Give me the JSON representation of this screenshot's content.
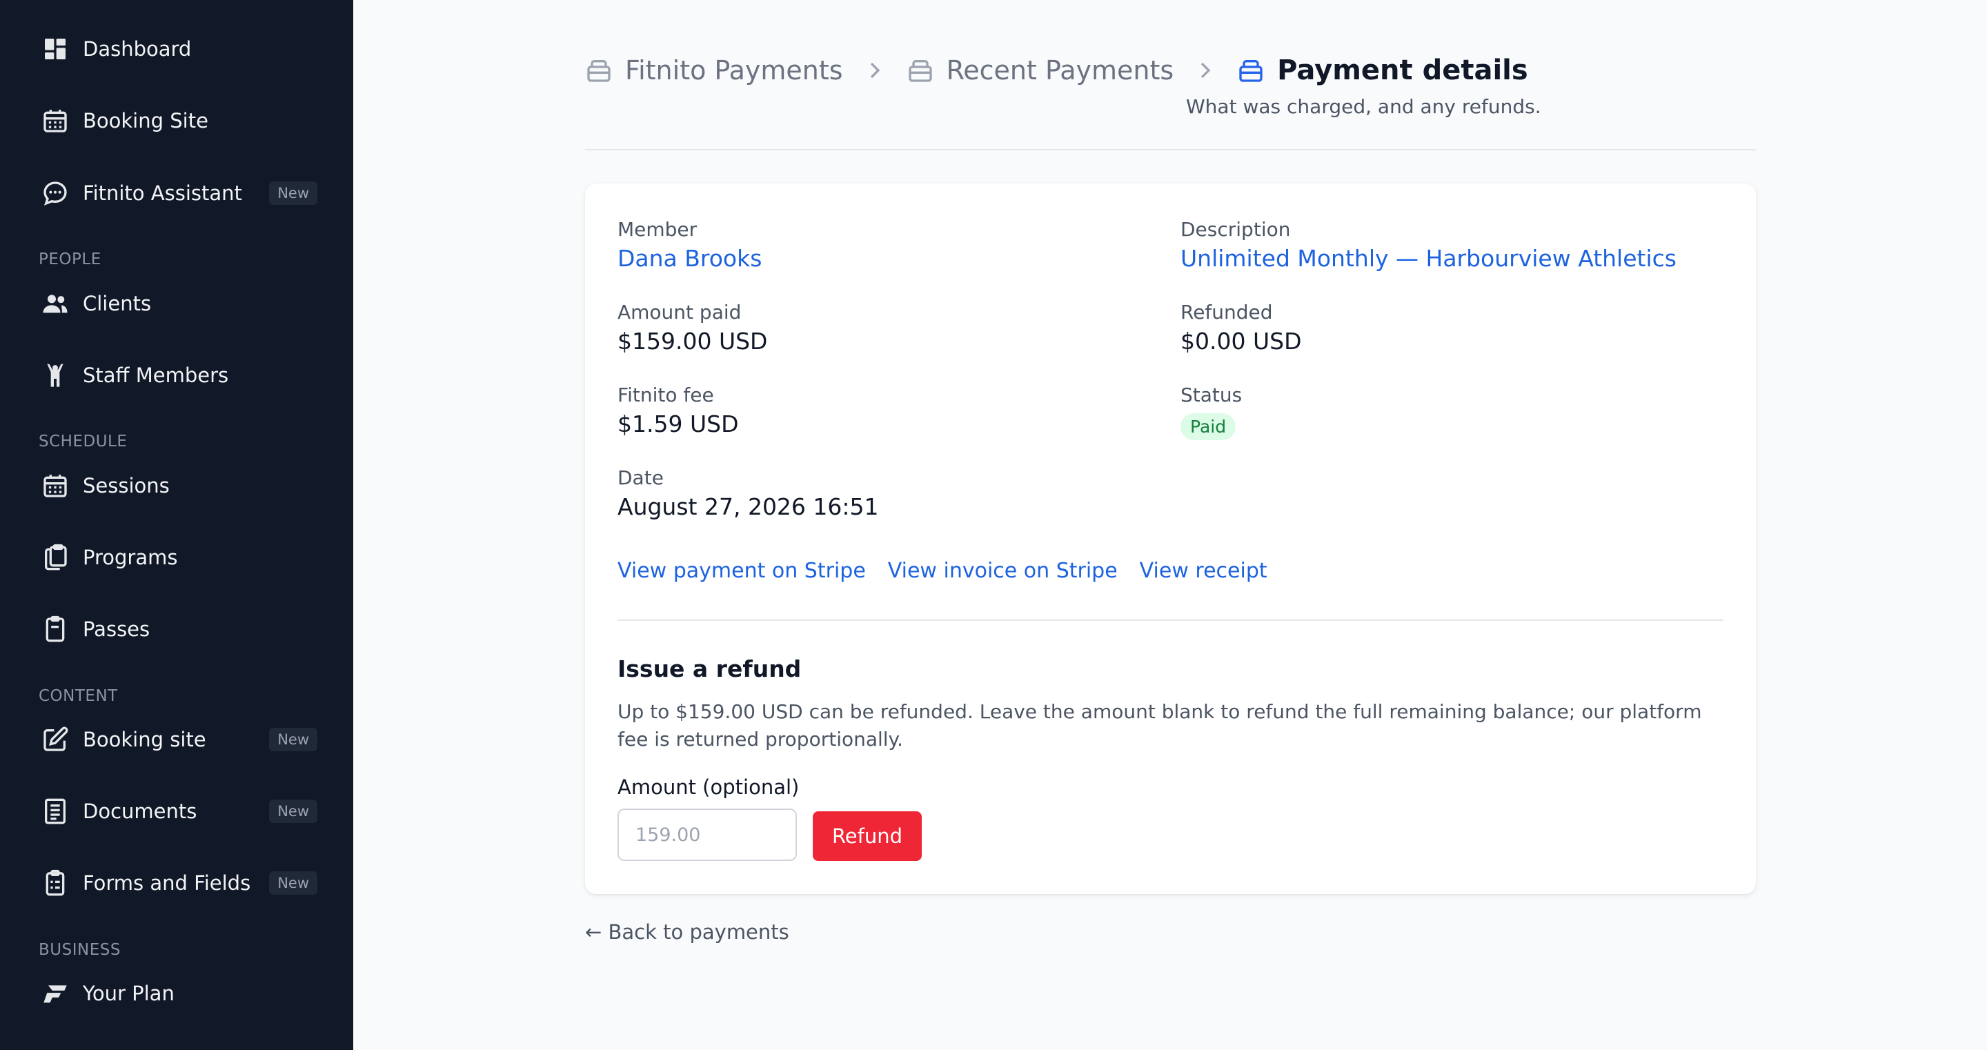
{
  "sidebar": {
    "items": [
      {
        "label": "Dashboard",
        "icon": "dashboard-icon"
      },
      {
        "label": "Booking Site",
        "icon": "calendar-icon"
      },
      {
        "label": "Fitnito Assistant",
        "icon": "chat-bubble-icon",
        "badge": "New"
      },
      {
        "label": "Clients",
        "icon": "users-icon"
      },
      {
        "label": "Staff Members",
        "icon": "person-raised-arms-icon"
      },
      {
        "label": "Sessions",
        "icon": "calendar-icon"
      },
      {
        "label": "Programs",
        "icon": "clipboard-stack-icon"
      },
      {
        "label": "Passes",
        "icon": "clipboard-icon"
      },
      {
        "label": "Booking site",
        "icon": "edit-square-icon",
        "badge": "New"
      },
      {
        "label": "Documents",
        "icon": "document-icon",
        "badge": "New"
      },
      {
        "label": "Forms and Fields",
        "icon": "clipboard-list-icon",
        "badge": "New"
      },
      {
        "label": "Your Plan",
        "icon": "fitnito-logo-icon"
      }
    ],
    "sections": [
      "PEOPLE",
      "SCHEDULE",
      "CONTENT",
      "BUSINESS"
    ]
  },
  "breadcrumb": {
    "items": [
      "Fitnito Payments",
      "Recent Payments",
      "Payment details"
    ],
    "subtitle": "What was charged, and any refunds."
  },
  "payment": {
    "member_label": "Member",
    "member": "Dana Brooks",
    "description_label": "Description",
    "description": "Unlimited Monthly — Harbourview Athletics",
    "amount_paid_label": "Amount paid",
    "amount_paid": "$159.00 USD",
    "refunded_label": "Refunded",
    "refunded": "$0.00 USD",
    "fee_label": "Fitnito fee",
    "fee": "$1.59 USD",
    "status_label": "Status",
    "status": "Paid",
    "date_label": "Date",
    "date": "August 27, 2026 16:51"
  },
  "links": {
    "stripe_payment": "View payment on Stripe",
    "stripe_invoice": "View invoice on Stripe",
    "receipt": "View receipt"
  },
  "refund": {
    "title": "Issue a refund",
    "description": "Up to $159.00 USD can be refunded. Leave the amount blank to refund the full remaining balance; our platform fee is returned proportionally.",
    "amount_label": "Amount (optional)",
    "amount_placeholder": "159.00",
    "button_label": "Refund"
  },
  "back_link": "← Back to payments",
  "colors": {
    "sidebar_bg": "#111827",
    "link": "#1d63e0",
    "danger": "#ef2636",
    "status_bg": "#dcfce7",
    "status_text": "#15803d"
  }
}
